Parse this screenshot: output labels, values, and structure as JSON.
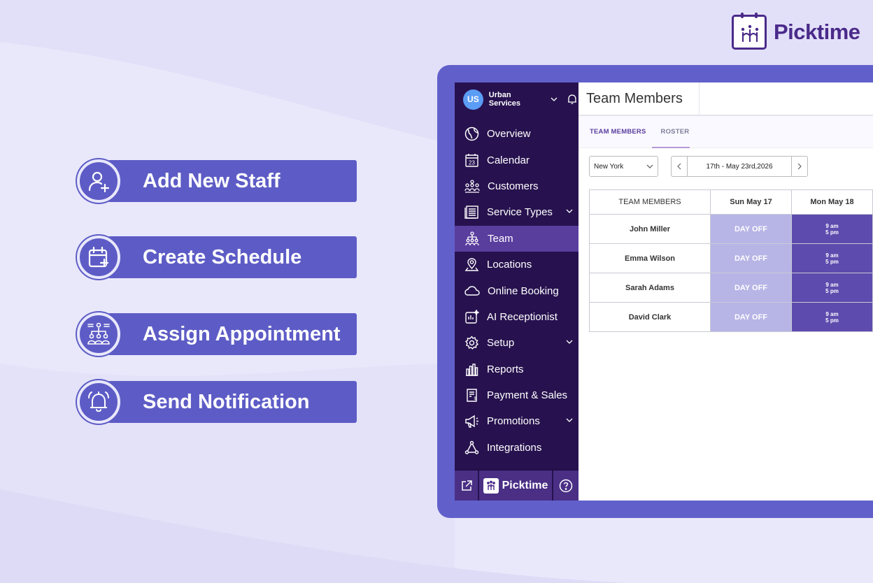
{
  "brand": {
    "name": "Picktime"
  },
  "features": [
    {
      "label": "Add New Staff",
      "icon": "add-user-icon"
    },
    {
      "label": "Create Schedule",
      "icon": "calendar-add-icon"
    },
    {
      "label": "Assign Appointment",
      "icon": "assign-team-icon"
    },
    {
      "label": "Send Notification",
      "icon": "bell-icon"
    }
  ],
  "app": {
    "org": {
      "initials": "US",
      "name": "Urban Services"
    },
    "nav": [
      {
        "label": "Overview",
        "icon": "globe-icon"
      },
      {
        "label": "Calendar",
        "icon": "calendar-icon",
        "icon_text": "23"
      },
      {
        "label": "Customers",
        "icon": "customers-icon"
      },
      {
        "label": "Service Types",
        "icon": "service-types-icon"
      },
      {
        "label": "Team",
        "icon": "team-icon",
        "active": true
      },
      {
        "label": "Locations",
        "icon": "location-pin-icon"
      },
      {
        "label": "Online Booking",
        "icon": "cloud-icon"
      },
      {
        "label": "AI Receptionist",
        "icon": "ai-icon"
      },
      {
        "label": "Setup",
        "icon": "gear-icon"
      },
      {
        "label": "Reports",
        "icon": "bar-chart-icon"
      },
      {
        "label": "Payment & Sales",
        "icon": "invoice-icon"
      },
      {
        "label": "Promotions",
        "icon": "megaphone-icon"
      },
      {
        "label": "Integrations",
        "icon": "integrations-icon"
      }
    ],
    "footer": {
      "brand": "Picktime"
    },
    "page_title": "Team Members",
    "tabs": [
      {
        "label": "TEAM MEMBERS",
        "active": true
      },
      {
        "label": "ROSTER",
        "active": false
      }
    ],
    "filters": {
      "location": "New York",
      "date_range": "17th - May 23rd,2026"
    },
    "table": {
      "headers": [
        "TEAM MEMBERS",
        "Sun May 17",
        "Mon May 18"
      ],
      "rows": [
        {
          "name": "John Miller",
          "sun": "DAY OFF",
          "mon": [
            "9 am",
            "5 pm"
          ]
        },
        {
          "name": "Emma Wilson",
          "sun": "DAY OFF",
          "mon": [
            "9 am",
            "5 pm"
          ]
        },
        {
          "name": "Sarah Adams",
          "sun": "DAY OFF",
          "mon": [
            "9 am",
            "5 pm"
          ]
        },
        {
          "name": "David Clark",
          "sun": "DAY OFF",
          "mon": [
            "9 am",
            "5 pm"
          ]
        }
      ]
    }
  },
  "colors": {
    "accent": "#5d5cc6",
    "sidebar": "#27124f",
    "active": "#5a3e9e",
    "dayoff": "#b7b5e6"
  }
}
